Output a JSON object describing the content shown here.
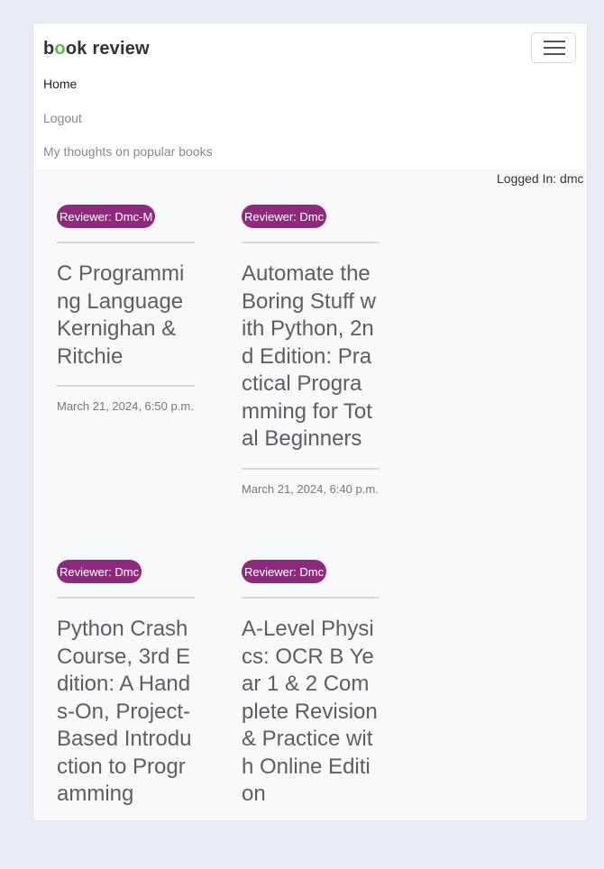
{
  "brand": {
    "b": "b",
    "o": "o",
    "rest": "ok review"
  },
  "nav": {
    "home": "Home",
    "logout": "Logout",
    "thoughts": "My thoughts on popular books"
  },
  "user": {
    "logged_in": "Logged In: dmc"
  },
  "reviews": [
    {
      "reviewer": "Reviewer: Dmc-M",
      "title": "C Programming Language Kernighan & Ritchie",
      "date": "March 21, 2024, 6:50 p.m."
    },
    {
      "reviewer": "Reviewer: Dmc",
      "title": "Automate the Boring Stuff with Python, 2nd Edition: Practical Programming for Total Beginners",
      "date": "March 21, 2024, 6:40 p.m."
    },
    {
      "reviewer": "Reviewer: Dmc",
      "title": "Python Crash Course, 3rd Edition: A Hands-On, Project-Based Introduction to Programming",
      "date": ""
    },
    {
      "reviewer": "Reviewer: Dmc",
      "title": "A-Level Physics: OCR B Year 1 & 2 Complete Revision & Practice with Online Edition",
      "date": ""
    }
  ],
  "colors": {
    "accent": "#8e2a7c",
    "brand_o": "#4dc247"
  },
  "icons": {
    "menu": "hamburger-menu-icon"
  }
}
